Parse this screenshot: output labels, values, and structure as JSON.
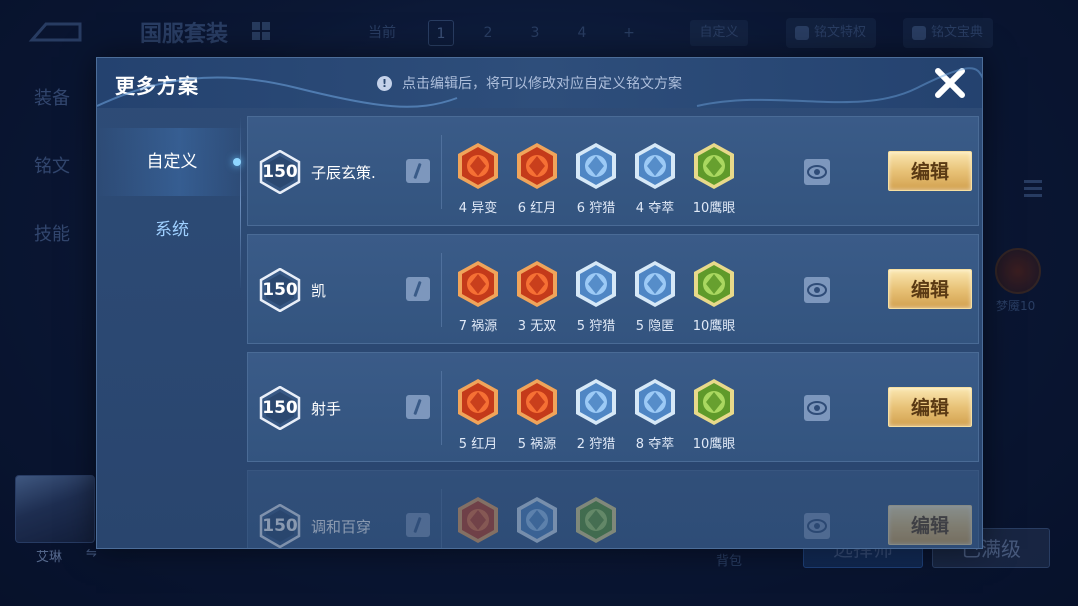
{
  "background": {
    "title": "国服套装",
    "tabs": {
      "current_label": "当前",
      "slots": [
        "1",
        "2",
        "3",
        "4",
        "+"
      ],
      "custom": "自定义"
    },
    "rune_privilege": "铭文特权",
    "rune_guide": "铭文宝典",
    "side_menu": [
      "装备",
      "铭文",
      "技能"
    ],
    "rune_preview_label": "梦魇10",
    "hero_name": "艾琳",
    "bag_label": "背包",
    "choose_button": "选择师",
    "full_level_button": "已满级"
  },
  "modal": {
    "title": "更多方案",
    "notice": "点击编辑后，将可以修改对应自定义铭文方案",
    "tabs": [
      {
        "label": "自定义",
        "active": true
      },
      {
        "label": "系统",
        "active": false
      }
    ],
    "edit_label": "编辑",
    "plans": [
      {
        "level": "150",
        "name": "子辰玄策.",
        "runes": [
          {
            "label": "4 异变",
            "color": "red",
            "icon": "mutation-rune-icon"
          },
          {
            "label": "6 红月",
            "color": "red",
            "icon": "red-moon-rune-icon"
          },
          {
            "label": "6 狩猎",
            "color": "blue",
            "icon": "hunt-rune-icon"
          },
          {
            "label": "4 夺萃",
            "color": "blue",
            "icon": "seize-rune-icon"
          },
          {
            "label": "10鹰眼",
            "color": "green",
            "icon": "hawk-eye-rune-icon"
          }
        ]
      },
      {
        "level": "150",
        "name": "凯",
        "runes": [
          {
            "label": "7 祸源",
            "color": "red",
            "icon": "calamity-rune-icon"
          },
          {
            "label": "3 无双",
            "color": "red",
            "icon": "peerless-rune-icon"
          },
          {
            "label": "5 狩猎",
            "color": "blue",
            "icon": "hunt-rune-icon"
          },
          {
            "label": "5 隐匿",
            "color": "blue",
            "icon": "stealth-rune-icon"
          },
          {
            "label": "10鹰眼",
            "color": "green",
            "icon": "hawk-eye-rune-icon"
          }
        ]
      },
      {
        "level": "150",
        "name": "射手",
        "runes": [
          {
            "label": "5 红月",
            "color": "red",
            "icon": "red-moon-rune-icon"
          },
          {
            "label": "5 祸源",
            "color": "red",
            "icon": "calamity-rune-icon"
          },
          {
            "label": "2 狩猎",
            "color": "blue",
            "icon": "hunt-rune-icon"
          },
          {
            "label": "8 夺萃",
            "color": "blue",
            "icon": "seize-rune-icon"
          },
          {
            "label": "10鹰眼",
            "color": "green",
            "icon": "hawk-eye-rune-icon"
          }
        ]
      },
      {
        "level": "150",
        "name": "调和百穿",
        "runes": [
          {
            "label": "",
            "color": "red",
            "icon": "mutation-rune-icon"
          },
          {
            "label": "",
            "color": "blue",
            "icon": "blade-rune-icon"
          },
          {
            "label": "",
            "color": "green",
            "icon": "hawk-eye-rune-icon"
          }
        ]
      }
    ]
  },
  "colors": {
    "red_rune": "#d2461f",
    "blue_rune": "#7fb1e0",
    "green_rune": "#8cc63e",
    "gold_button": "#e8c277",
    "modal_bg": "#2e4c77"
  }
}
